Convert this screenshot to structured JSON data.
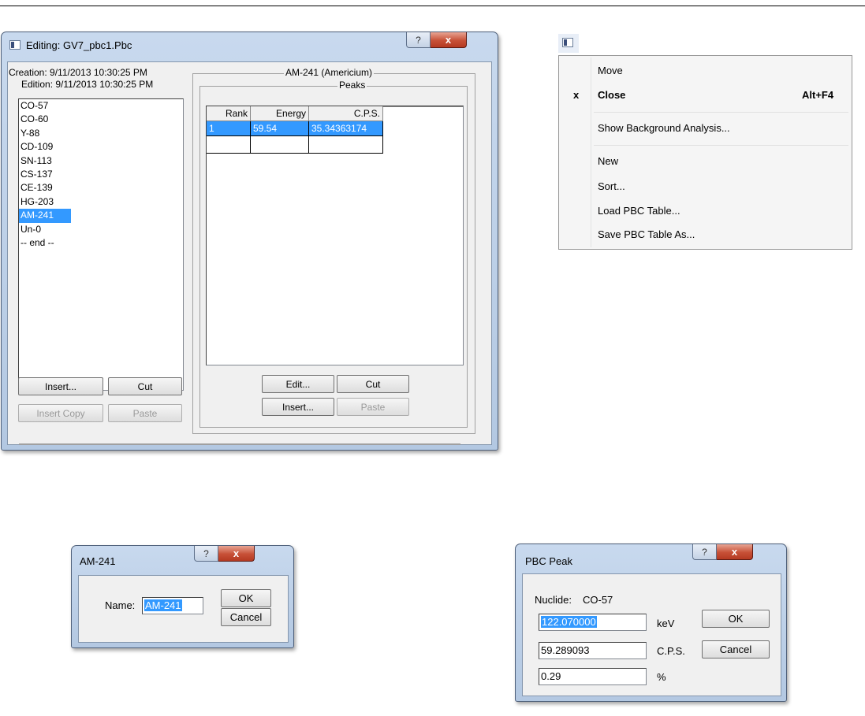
{
  "editor": {
    "title": "Editing: GV7_pbc1.Pbc",
    "help": "?",
    "close": "x",
    "creation": "Creation: 9/11/2013  10:30:25 PM",
    "edition": "Edition: 9/11/2013  10:30:25 PM",
    "nuclides": [
      "CO-57",
      "CO-60",
      "Y-88",
      "CD-109",
      "SN-113",
      "CS-137",
      "CE-139",
      "HG-203",
      "AM-241",
      "Un-0",
      "-- end --"
    ],
    "selected_nuclide_index": 8,
    "nuclide_group": "AM-241 (Americium)",
    "peaks_group": "Peaks",
    "columns": [
      "Rank",
      "Energy",
      "C.P.S."
    ],
    "rows": [
      [
        "1",
        "59.54",
        "35.34363174"
      ]
    ],
    "left_buttons": {
      "insert": "Insert...",
      "cut": "Cut",
      "insert_copy": "Insert Copy",
      "paste": "Paste"
    },
    "right_buttons": {
      "edit": "Edit...",
      "cut": "Cut",
      "insert": "Insert...",
      "paste": "Paste"
    }
  },
  "context_menu": {
    "items": {
      "move": "Move",
      "close": "Close",
      "close_mark": "x",
      "close_shortcut": "Alt+F4",
      "show_bg": "Show Background Analysis...",
      "new": "New",
      "sort": "Sort...",
      "load": "Load PBC Table...",
      "save": "Save PBC Table As..."
    }
  },
  "name_dialog": {
    "title": "AM-241",
    "name_label": "Name:",
    "name_value": "AM-241",
    "ok": "OK",
    "cancel": "Cancel"
  },
  "peak_dialog": {
    "title": "PBC Peak",
    "nuclide_label": "Nuclide:",
    "nuclide_value": "CO-57",
    "energy": "122.070000",
    "energy_unit": "keV",
    "cps": "59.289093",
    "cps_unit": "C.P.S.",
    "pct": "0.29",
    "pct_unit": "%",
    "ok": "OK",
    "cancel": "Cancel"
  }
}
